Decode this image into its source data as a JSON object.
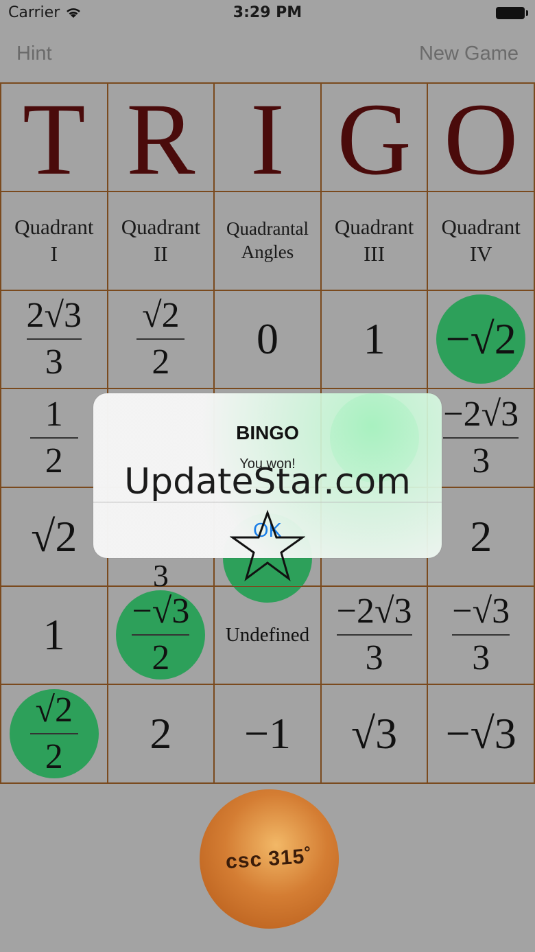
{
  "status": {
    "carrier": "Carrier",
    "time": "3:29 PM"
  },
  "nav": {
    "hint": "Hint",
    "new_game": "New Game"
  },
  "board": {
    "letters": [
      "T",
      "R",
      "I",
      "G",
      "O"
    ],
    "headers": [
      "Quadrant\nI",
      "Quadrant\nII",
      "Quadrantal\nAngles",
      "Quadrant\nIII",
      "Quadrant\nIV"
    ],
    "cells": {
      "r1c1_num": "2√3",
      "r1c1_den": "3",
      "r1c2_num": "√2",
      "r1c2_den": "2",
      "r1c3": "0",
      "r1c4": "1",
      "r1c5": "−√2",
      "r2c1_num": "1",
      "r2c1_den": "2",
      "r2c5_num": "−2√3",
      "r2c5_den": "3",
      "r3c1": "√2",
      "r3c2_den": "3",
      "r3c5": "2",
      "r4c1": "1",
      "r4c2_num": "−√3",
      "r4c2_den": "2",
      "r4c3": "Undefined",
      "r4c4_num": "−2√3",
      "r4c4_den": "3",
      "r4c5_num": "−√3",
      "r4c5_den": "3",
      "r5c1_num": "√2",
      "r5c1_den": "2",
      "r5c2": "2",
      "r5c3": "−1",
      "r5c4": "√3",
      "r5c5": "−√3"
    }
  },
  "ball": {
    "text": "csc 315˚"
  },
  "dialog": {
    "title": "BINGO",
    "message": "You won!",
    "ok": "OK"
  },
  "watermark": "UpdateStar.com",
  "colors": {
    "marker": "#2da05a",
    "letter": "#4a0b0b",
    "grid_line": "#7a4a1e",
    "ok_blue": "#1a7ee8"
  }
}
